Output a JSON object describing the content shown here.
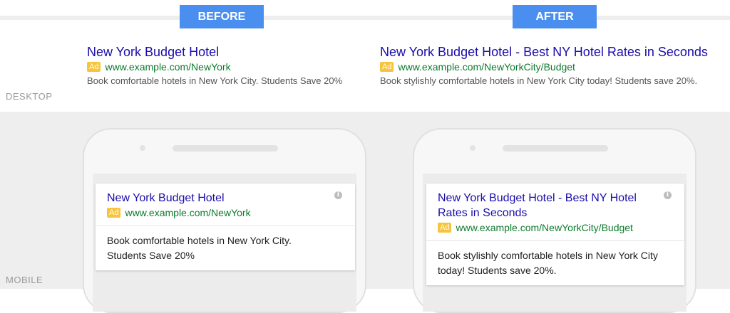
{
  "labels": {
    "before": "BEFORE",
    "after": "AFTER",
    "desktop": "DESKTOP",
    "mobile": "MOBILE"
  },
  "ad_tag": "Ad",
  "desktop": {
    "before": {
      "title": "New York Budget Hotel",
      "url": "www.example.com/NewYork",
      "description": "Book comfortable hotels in New York City. Students Save 20%"
    },
    "after": {
      "title": "New York Budget Hotel - Best NY Hotel Rates in Seconds",
      "url": "www.example.com/NewYorkCity/Budget",
      "description": "Book stylishly comfortable hotels in New York City today! Students save 20%."
    }
  },
  "mobile": {
    "before": {
      "title": "New York Budget Hotel",
      "url": "www.example.com/NewYork",
      "description": "Book comfortable hotels in New York City. Students Save 20%"
    },
    "after": {
      "title": "New York Budget Hotel - Best NY Hotel Rates in Seconds",
      "url": "www.example.com/NewYorkCity/Budget",
      "description": "Book stylishly comfortable hotels in New York City today! Students save 20%."
    }
  },
  "colors": {
    "badge": "#4a8ff0",
    "title_link": "#1a0dab",
    "url": "#0e7a2e",
    "ad_tag": "#f8c43b"
  },
  "icons": {
    "info": "info-icon"
  }
}
